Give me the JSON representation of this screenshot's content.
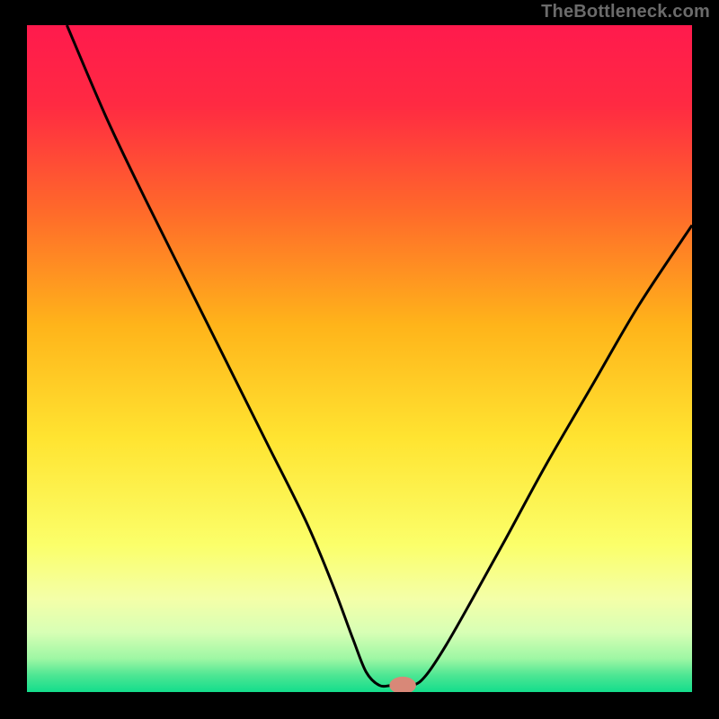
{
  "watermark": "TheBottleneck.com",
  "chart_data": {
    "type": "line",
    "title": "",
    "xlabel": "",
    "ylabel": "",
    "xlim": [
      0,
      100
    ],
    "ylim": [
      0,
      100
    ],
    "background_gradient_stops": [
      {
        "offset": 0.0,
        "color": "#ff1a4d"
      },
      {
        "offset": 0.12,
        "color": "#ff2a42"
      },
      {
        "offset": 0.28,
        "color": "#ff6a2a"
      },
      {
        "offset": 0.45,
        "color": "#ffb41a"
      },
      {
        "offset": 0.62,
        "color": "#ffe431"
      },
      {
        "offset": 0.78,
        "color": "#fbff6a"
      },
      {
        "offset": 0.86,
        "color": "#f4ffa8"
      },
      {
        "offset": 0.91,
        "color": "#d8ffb5"
      },
      {
        "offset": 0.95,
        "color": "#9ef7a4"
      },
      {
        "offset": 0.975,
        "color": "#4de693"
      },
      {
        "offset": 1.0,
        "color": "#13dd8c"
      }
    ],
    "series": [
      {
        "name": "bottleneck-curve",
        "type": "line",
        "points": [
          {
            "x": 6.0,
            "y": 100.0
          },
          {
            "x": 12.0,
            "y": 86.0
          },
          {
            "x": 18.0,
            "y": 73.5
          },
          {
            "x": 24.0,
            "y": 61.5
          },
          {
            "x": 30.0,
            "y": 49.5
          },
          {
            "x": 36.0,
            "y": 37.5
          },
          {
            "x": 42.0,
            "y": 25.5
          },
          {
            "x": 46.0,
            "y": 16.0
          },
          {
            "x": 49.0,
            "y": 8.0
          },
          {
            "x": 51.0,
            "y": 3.0
          },
          {
            "x": 53.0,
            "y": 1.0
          },
          {
            "x": 55.0,
            "y": 1.0
          },
          {
            "x": 58.0,
            "y": 1.0
          },
          {
            "x": 60.0,
            "y": 2.5
          },
          {
            "x": 63.0,
            "y": 7.0
          },
          {
            "x": 67.0,
            "y": 14.0
          },
          {
            "x": 72.0,
            "y": 23.0
          },
          {
            "x": 78.0,
            "y": 34.0
          },
          {
            "x": 85.0,
            "y": 46.0
          },
          {
            "x": 92.0,
            "y": 58.0
          },
          {
            "x": 100.0,
            "y": 70.0
          }
        ]
      }
    ],
    "marker": {
      "x": 56.5,
      "y": 1.0,
      "rx": 2.0,
      "ry": 1.3,
      "color": "#d88878"
    }
  }
}
